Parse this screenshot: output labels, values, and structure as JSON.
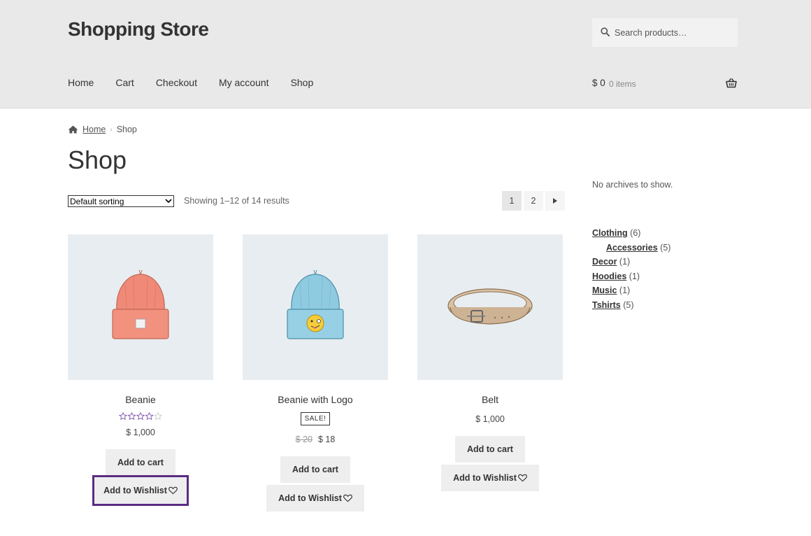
{
  "site": {
    "title": "Shopping Store"
  },
  "search": {
    "placeholder": "Search products…"
  },
  "nav": {
    "items": [
      "Home",
      "Cart",
      "Checkout",
      "My account",
      "Shop"
    ]
  },
  "cart": {
    "total": "$ 0",
    "count": "0 items"
  },
  "breadcrumb": {
    "home": "Home",
    "current": "Shop"
  },
  "page": {
    "title": "Shop"
  },
  "toolbar": {
    "sorting": "Default sorting",
    "results": "Showing 1–12 of 14 results",
    "pages": [
      "1",
      "2"
    ]
  },
  "products": [
    {
      "name": "Beanie",
      "rating": 3.5,
      "price": "$ 1,000",
      "add_to_cart": "Add to cart",
      "wishlist": "Add to Wishlist"
    },
    {
      "name": "Beanie with Logo",
      "sale_badge": "SALE!",
      "old_price": "$ 20",
      "price": "$ 18",
      "add_to_cart": "Add to cart",
      "wishlist": "Add to Wishlist"
    },
    {
      "name": "Belt",
      "price": "$ 1,000",
      "add_to_cart": "Add to cart",
      "wishlist": "Add to Wishlist"
    }
  ],
  "sidebar": {
    "archives_empty": "No archives to show.",
    "categories": [
      {
        "name": "Clothing",
        "count": "(6)"
      },
      {
        "name": "Accessories",
        "count": "(5)"
      },
      {
        "name": "Decor",
        "count": "(1)"
      },
      {
        "name": "Hoodies",
        "count": "(1)"
      },
      {
        "name": "Music",
        "count": "(1)"
      },
      {
        "name": "Tshirts",
        "count": "(5)"
      }
    ]
  },
  "colors": {
    "header_bg": "#e9e9e9",
    "highlight": "#5a2d82",
    "star": "#7e57a8",
    "product_bg": "#e8edf1"
  }
}
